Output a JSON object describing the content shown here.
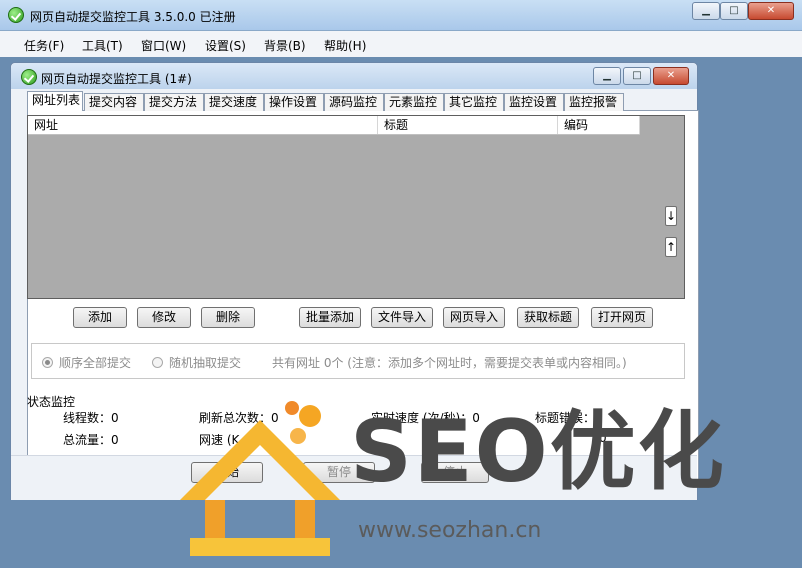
{
  "window": {
    "title": "网页自动提交监控工具 3.5.0.0  已注册",
    "minimize": "▁",
    "maximize": "□",
    "close": "✕"
  },
  "menu": [
    "任务(F)",
    "工具(T)",
    "窗口(W)",
    "设置(S)",
    "背景(B)",
    "帮助(H)"
  ],
  "child": {
    "title": "网页自动提交监控工具  (1#)",
    "minimize": "▁",
    "maximize": "□",
    "close": "✕"
  },
  "tabs": [
    "网址列表",
    "提交内容",
    "提交方法",
    "提交速度",
    "操作设置",
    "源码监控",
    "元素监控",
    "其它监控",
    "监控设置",
    "监控报警"
  ],
  "active_tab": 0,
  "list": {
    "columns": [
      "网址",
      "标题",
      "编码"
    ],
    "rows": [],
    "down_arrow": "↓",
    "up_arrow": "↑"
  },
  "buttons": [
    "添加",
    "修改",
    "删除",
    "批量添加",
    "文件导入",
    "网页导入",
    "获取标题",
    "打开网页"
  ],
  "options": {
    "sequential": "顺序全部提交",
    "random": "随机抽取提交",
    "info": "共有网址  0个 (注意：添加多个网址时，需要提交表单或内容相同。)"
  },
  "status": {
    "title": "状态监控",
    "threads": "线程数：0",
    "refresh_total": "刷新总次数：0",
    "speed": "实时速度 (次/秒)：0",
    "title_errors": "标题错误：0",
    "total_traffic": "总流量：0",
    "net_speed": "网速 (K",
    "row2_value": "0"
  },
  "controls": {
    "start": "开始",
    "pause": "暂停",
    "stop": "停止"
  },
  "watermark": {
    "brand": "SEO优化",
    "url": "www.seozhan.cn"
  }
}
